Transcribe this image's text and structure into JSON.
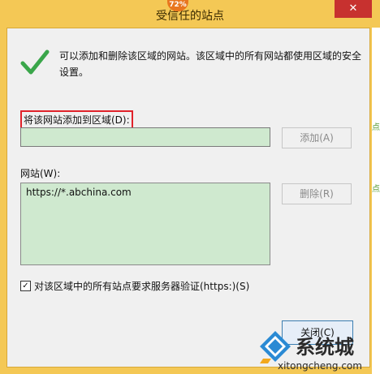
{
  "window": {
    "title": "受信任的站点",
    "close_label": "✕",
    "badge": "72%"
  },
  "background": {
    "right_text_1": "点",
    "right_text_2": "点"
  },
  "dialog": {
    "intro": "可以添加和删除该区域的网站。该区域中的所有网站都使用区域的安全设置。",
    "add_label": "将该网站添加到区域(D):",
    "add_input_value": "",
    "add_button": "添加(A)",
    "sites_label": "网站(W):",
    "sites": [
      "https://*.abchina.com"
    ],
    "remove_button": "删除(R)",
    "https_checkbox_label": "对该区域中的所有站点要求服务器验证(https:)(S)",
    "https_checked": true,
    "close_button": "关闭(C)"
  },
  "watermark": {
    "text": "系统城",
    "url": "xitongcheng.com"
  }
}
